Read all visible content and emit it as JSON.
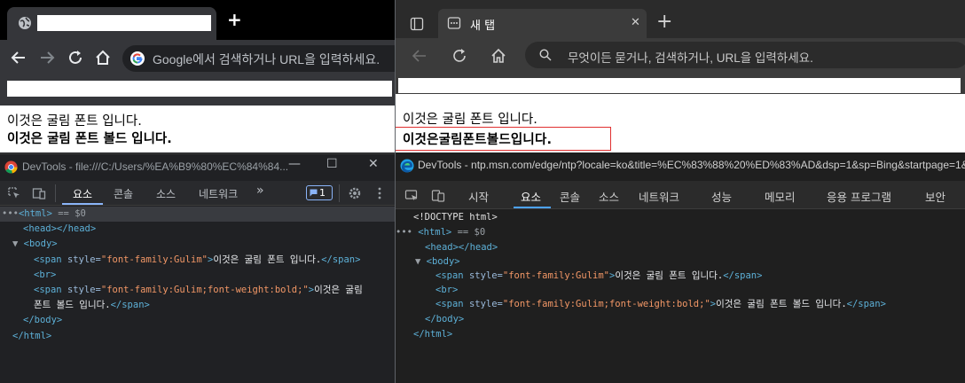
{
  "chrome": {
    "new_tab_symbol": "+",
    "omnibox_placeholder": "Google에서 검색하거나 URL을 입력하세요.",
    "page_lines": [
      "이것은 굴림 폰트 입니다.",
      "이것은 굴림 폰트 볼드 입니다."
    ],
    "devtools": {
      "title": "DevTools - file:///C:/Users/%EA%B9%80%EC%84%84...",
      "window_buttons": [
        "—",
        "☐",
        "✕"
      ],
      "tabs": [
        "요소",
        "콘솔",
        "소스",
        "네트워크"
      ],
      "more_tabs": "»",
      "issues_count": "1",
      "dom": {
        "html_open": "<html>",
        "selected_marker": "== $0",
        "ellipsis": "•••",
        "head": "<head></head>",
        "body_open": "<body>",
        "span1_open": "<span ",
        "span1_attr": "style=",
        "span1_val": "\"font-family:Gulim\"",
        "span1_close_bracket": ">",
        "span1_text": "이것은 굴림 폰트 입니다.",
        "span1_end": "</span>",
        "br": "<br>",
        "span2_open": "<span ",
        "span2_attr": "style=",
        "span2_val": "\"font-family:Gulim;font-weight:bold;\"",
        "span2_close_bracket": ">",
        "span2_text_a": "이것은 굴림",
        "span2_text_b": "폰트 볼드 입니다.",
        "span2_end": "</span>",
        "body_close": "</body>",
        "html_close": "</html>"
      }
    }
  },
  "edge": {
    "tab_title": "새 탭",
    "tab_close": "✕",
    "new_tab_symbol": "+",
    "omnibox_placeholder": "무엇이든 묻거나, 검색하거나, URL을 입력하세요.",
    "page_lines": [
      "이것은 굴림 폰트 입니다.",
      "이것은굴림폰트볼드입니다."
    ],
    "devtools": {
      "title": "DevTools - ntp.msn.com/edge/ntp?locale=ko&title=%EC%83%88%20%ED%83%AD&dsp=1&sp=Bing&startpage=1&",
      "tabs": [
        "시작",
        "요소",
        "콘솔",
        "소스",
        "네트워크",
        "성능",
        "메모리",
        "응용 프로그램",
        "보안"
      ],
      "dom": {
        "doctype": "<!DOCTYPE html>",
        "html_open": "<html>",
        "selected_marker": "== $0",
        "ellipsis": "•••",
        "head": "<head></head>",
        "body_open": "<body>",
        "span1_open": "<span ",
        "span1_attr": "style=",
        "span1_val": "\"font-family:Gulim\"",
        "span1_close_bracket": ">",
        "span1_text": "이것은 굴림 폰트 입니다.",
        "span1_end": "</span>",
        "br": "<br>",
        "span2_open": "<span ",
        "span2_attr": "style=",
        "span2_val": "\"font-family:Gulim;font-weight:bold;\"",
        "span2_close_bracket": ">",
        "span2_text": "이것은 굴림 폰트 볼드 입니다.",
        "span2_end": "</span>",
        "body_close": "</body>",
        "html_close": "</html>"
      }
    }
  },
  "colors": {
    "highlight_border": "#e03030",
    "devtools_tag": "#5db0d7",
    "devtools_attr_value": "#f29766",
    "active_tab_underline": "#8ab4f8"
  }
}
